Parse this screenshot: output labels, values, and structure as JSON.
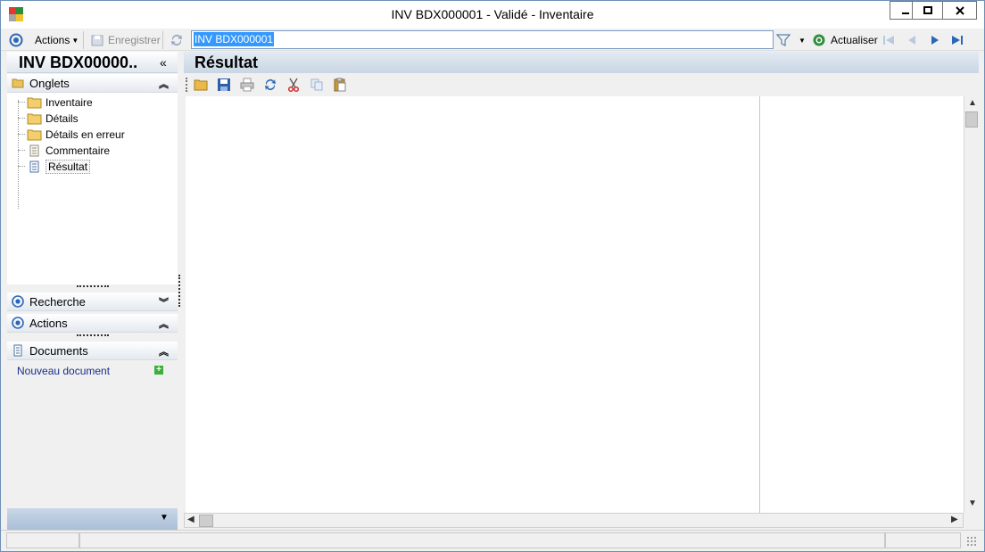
{
  "window": {
    "title": "INV BDX000001 - Validé -  Inventaire"
  },
  "toolbar": {
    "actions_label": "Actions",
    "save_label": "Enregistrer",
    "search_value": "INV BDX000001",
    "refresh_label": "Actualiser"
  },
  "left_panel": {
    "title": "INV BDX00000..",
    "tabs_section": "Onglets",
    "tree_items": [
      "Inventaire",
      "Détails",
      "Détails en erreur",
      "Commentaire",
      "Résultat"
    ],
    "search_section": "Recherche",
    "actions_section": "Actions",
    "documents_section": "Documents",
    "new_document_label": "Nouveau document"
  },
  "main": {
    "title": "Résultat"
  },
  "colors": {
    "accent": "#3399ff",
    "link": "#1a2e8a",
    "header_gradient_top": "#e3eaf2",
    "header_gradient_bottom": "#c9d6e4"
  }
}
